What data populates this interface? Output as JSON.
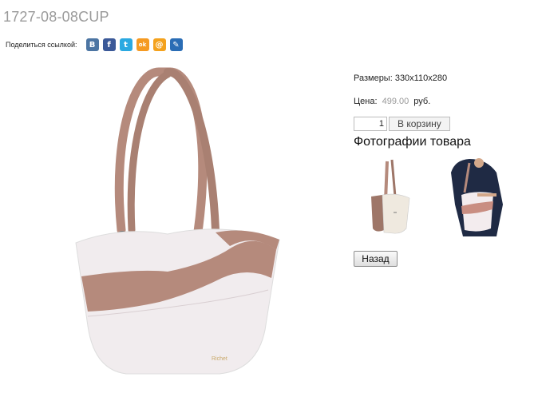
{
  "product": {
    "title": "1727-08-08CUP",
    "sizes_text": "Размеры: 330x110x280",
    "price_label": "Цена:",
    "price_value": "499.00",
    "price_currency": "руб.",
    "quantity": "1",
    "cart_button": "В корзину",
    "photos_heading": "Фотографии товара",
    "back_button": "Назад",
    "brand_mark": "Richet"
  },
  "share": {
    "label": "Поделиться ссылкой:",
    "icons": [
      {
        "name": "vkontakte-icon",
        "glyph": "B",
        "color": "#4c75a3"
      },
      {
        "name": "facebook-icon",
        "glyph": "f",
        "color": "#3b5998"
      },
      {
        "name": "twitter-icon",
        "glyph": "t",
        "color": "#2ba9e1"
      },
      {
        "name": "odnoklassniki-icon",
        "glyph": "ok",
        "color": "#f59a22"
      },
      {
        "name": "mailru-icon",
        "glyph": "@",
        "color": "#f4a21d"
      },
      {
        "name": "livejournal-icon",
        "glyph": "✎",
        "color": "#2a6db5"
      }
    ]
  },
  "colors": {
    "bag_pink": "#b58a7c",
    "bag_white": "#f1ecee",
    "title_gray": "#9a9a9a"
  }
}
